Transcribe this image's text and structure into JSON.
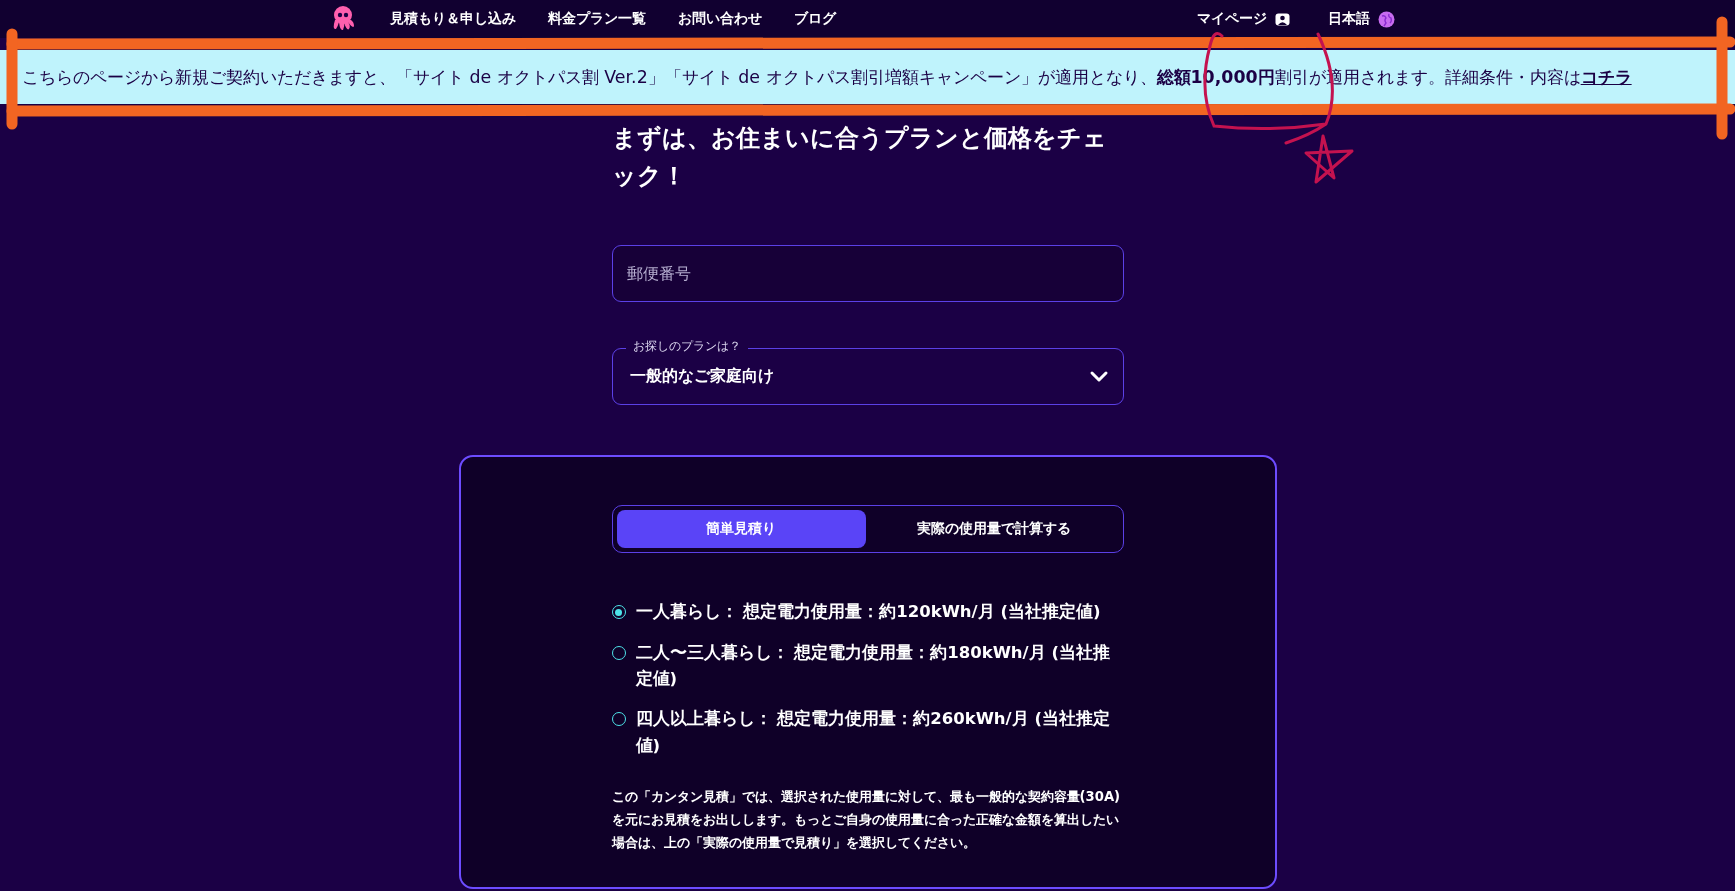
{
  "nav": {
    "links": [
      "見積もり＆申し込み",
      "料金プラン一覧",
      "お問い合わせ",
      "ブログ"
    ],
    "mypage": "マイページ",
    "language": "日本語"
  },
  "banner": {
    "text": "こちらのページから新規ご契約いただきますと、「サイト de オクトパス割 Ver.2」「サイト de オクトパス割引増額キャンペーン」が適用となり、**総額10,000円**割引が適用されます。詳細条件・内容は",
    "link": "コチラ"
  },
  "heading": "まずは、お住まいに合うプランと価格をチェック！",
  "postcode_field": {
    "placeholder": "郵便番号"
  },
  "plan_select": {
    "label": "お探しのプランは？",
    "value": "一般的なご家庭向け"
  },
  "estimate_card": {
    "tabs": [
      {
        "label": "簡単見積り",
        "selected": true
      },
      {
        "label": "実際の使用量で計算する",
        "selected": false
      }
    ],
    "options": [
      {
        "label": "一人暮らし： 想定電力使用量：約120kWh/月 (当社推定値)",
        "selected": true
      },
      {
        "label": "二人〜三人暮らし： 想定電力使用量：約180kWh/月 (当社推定値)",
        "selected": false
      },
      {
        "label": "四人以上暮らし： 想定電力使用量：約260kWh/月 (当社推定値)",
        "selected": false
      }
    ],
    "note": "この「カンタン見積」では、選択された使用量に対して、最も一般的な契約容量(30A)を元にお見積をお出しします。もっとご自身の使用量に合った正確な金額を算出したい場合は、上の「実際の使用量で見積り」を選択してください。"
  }
}
